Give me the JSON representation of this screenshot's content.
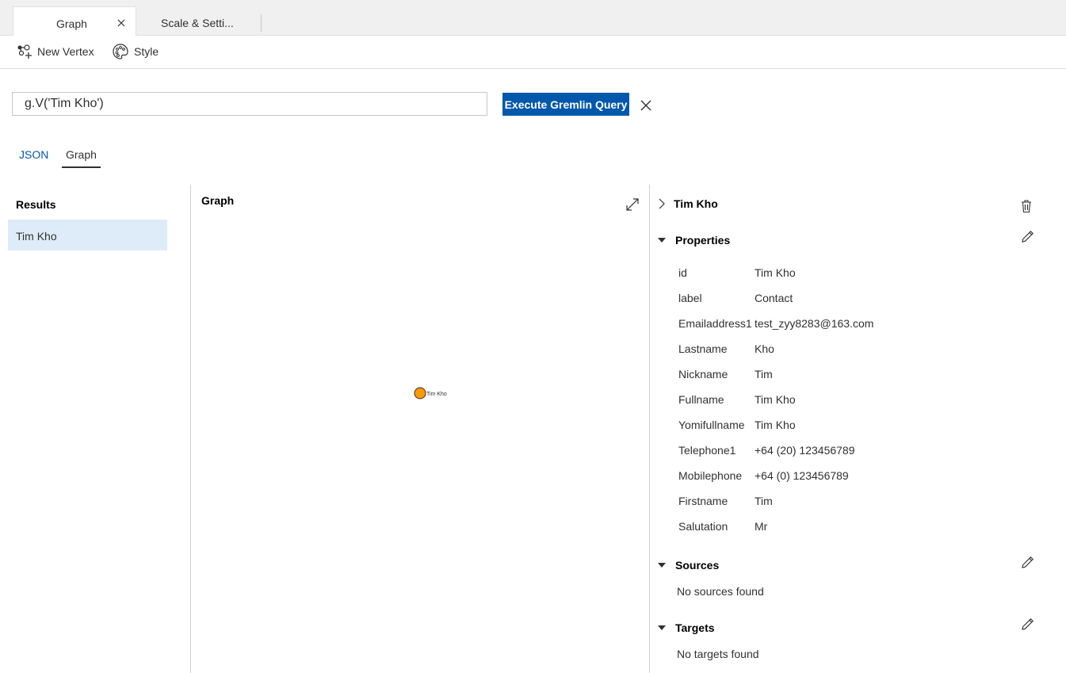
{
  "tabs": [
    {
      "label": "Graph",
      "active": true
    },
    {
      "label": "Scale & Setti..."
    }
  ],
  "toolbar": {
    "new_vertex_label": "New Vertex",
    "style_label": "Style"
  },
  "query": {
    "value": "g.V('Tim Kho')",
    "execute_label": "Execute Gremlin Query"
  },
  "view_tabs": {
    "json_label": "JSON",
    "graph_label": "Graph",
    "selected": "Graph"
  },
  "results": {
    "title": "Results",
    "items": [
      "Tim Kho"
    ]
  },
  "graph": {
    "title": "Graph",
    "node_label": "Tim Kho",
    "node_color": "#ff9900"
  },
  "details": {
    "node_title": "Tim Kho",
    "properties_title": "Properties",
    "properties": [
      {
        "key": "id",
        "value": "Tim Kho"
      },
      {
        "key": "label",
        "value": "Contact"
      },
      {
        "key": "Emailaddress1",
        "value": "test_zyy8283@163.com"
      },
      {
        "key": "Lastname",
        "value": "Kho"
      },
      {
        "key": "Nickname",
        "value": "Tim"
      },
      {
        "key": "Fullname",
        "value": "Tim Kho"
      },
      {
        "key": "Yomifullname",
        "value": "Tim Kho"
      },
      {
        "key": "Telephone1",
        "value": "+64 (20) 123456789"
      },
      {
        "key": "Mobilephone",
        "value": "+64 (0) 123456789"
      },
      {
        "key": "Firstname",
        "value": "Tim"
      },
      {
        "key": "Salutation",
        "value": "Mr"
      }
    ],
    "sources_title": "Sources",
    "sources_empty": "No sources found",
    "targets_title": "Targets",
    "targets_empty": "No targets found"
  },
  "colors": {
    "accent": "#0058ad",
    "selected_row": "#deecf9"
  }
}
